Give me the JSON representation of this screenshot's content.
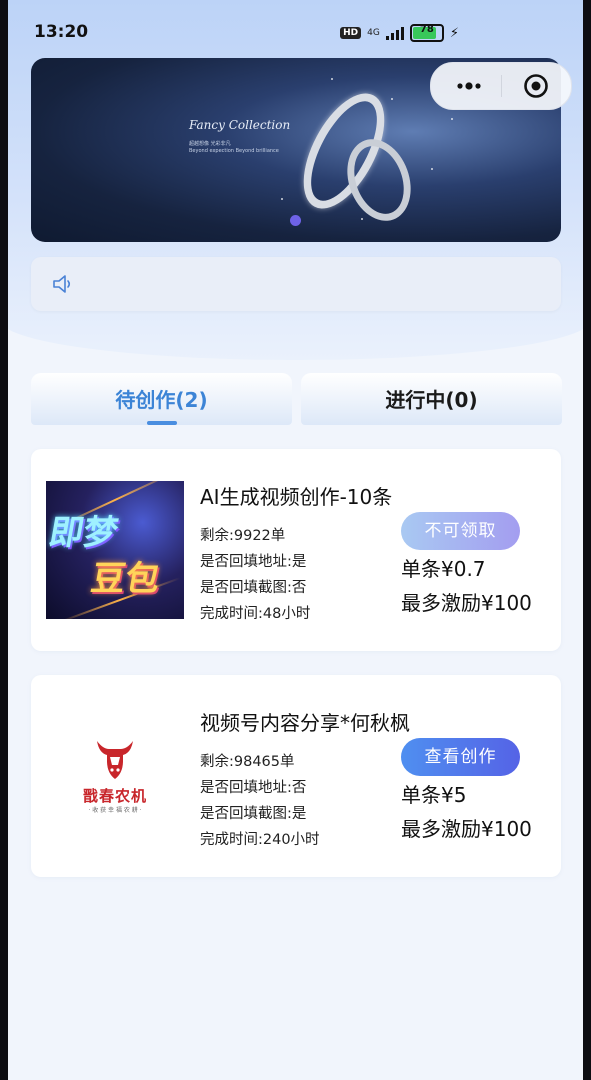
{
  "status_bar": {
    "time": "13:20",
    "hd": "HD",
    "network": "4G",
    "battery": "78",
    "battery_level_percent": 78
  },
  "banner": {
    "title": "Fancy Collection",
    "subtitle_line1": "超越想像 光彩非凡",
    "subtitle_line2": "Beyond expection Beyond brilliance",
    "active_slide": 1,
    "slide_count": 1
  },
  "notice": {
    "icon": "speaker-icon",
    "text": ""
  },
  "tabs": [
    {
      "label": "待创作(2)",
      "active": true
    },
    {
      "label": "进行中(0)",
      "active": false
    }
  ],
  "tasks": [
    {
      "title": "AI生成视频创作-10条",
      "thumb_line1": "即梦",
      "thumb_line2": "豆包",
      "remaining": "剩余:9922单",
      "fill_address": "是否回填地址:是",
      "fill_screenshot": "是否回填截图:否",
      "duration": "完成时间:48小时",
      "button": "不可领取",
      "button_enabled": false,
      "price": "单条¥0.7",
      "reward": "最多激励¥100"
    },
    {
      "title": "视频号内容分享*何秋枫",
      "thumb_brand": "戬春农机",
      "thumb_brand_sub": "· 收 获 幸 福 农 耕 ·",
      "remaining": "剩余:98465单",
      "fill_address": "是否回填地址:否",
      "fill_screenshot": "是否回填截图:是",
      "duration": "完成时间:240小时",
      "button": "查看创作",
      "button_enabled": true,
      "price": "单条¥5",
      "reward": "最多激励¥100"
    }
  ],
  "colors": {
    "accent": "#3c84d6",
    "button_active": "#4f8ff0",
    "button_disabled": "#a9c9f2",
    "brand_red": "#c8262b"
  }
}
